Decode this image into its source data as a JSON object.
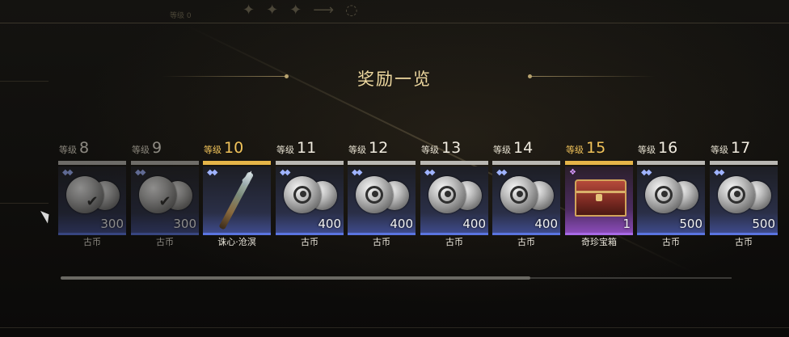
{
  "header": {
    "title": "奖励一览",
    "faint_label": "等级 0",
    "top_icons": [
      "badge-icon",
      "badge-icon",
      "badge-icon",
      "arrow-icon",
      "refresh-icon"
    ]
  },
  "level_label": "等级",
  "rewards": [
    {
      "level": "8",
      "name": "古币",
      "qty": "300",
      "rarity": "blue",
      "icon": "badge-coin-icon",
      "dim": true
    },
    {
      "level": "9",
      "name": "古币",
      "qty": "300",
      "rarity": "blue",
      "icon": "badge-coin-icon",
      "dim": true
    },
    {
      "level": "10",
      "name": "诛心·沧溟",
      "qty": "",
      "rarity": "blue",
      "icon": "spear-icon",
      "highlight": true
    },
    {
      "level": "11",
      "name": "古币",
      "qty": "400",
      "rarity": "blue",
      "icon": "coin-icon"
    },
    {
      "level": "12",
      "name": "古币",
      "qty": "400",
      "rarity": "blue",
      "icon": "coin-icon"
    },
    {
      "level": "13",
      "name": "古币",
      "qty": "400",
      "rarity": "blue",
      "icon": "coin-icon"
    },
    {
      "level": "14",
      "name": "古币",
      "qty": "400",
      "rarity": "blue",
      "icon": "coin-icon"
    },
    {
      "level": "15",
      "name": "奇珍宝箱",
      "qty": "1",
      "rarity": "purple",
      "icon": "treasure-chest-icon",
      "highlight": true
    },
    {
      "level": "16",
      "name": "古币",
      "qty": "500",
      "rarity": "blue",
      "icon": "coin-icon"
    },
    {
      "level": "17",
      "name": "古币",
      "qty": "500",
      "rarity": "blue",
      "icon": "coin-icon"
    }
  ],
  "scroll": {
    "position": 0.7
  },
  "colors": {
    "highlight": "#e6b548",
    "blue_rarity": "#5a74e0",
    "purple_rarity": "#a76ae6",
    "title": "#efd9a0"
  }
}
